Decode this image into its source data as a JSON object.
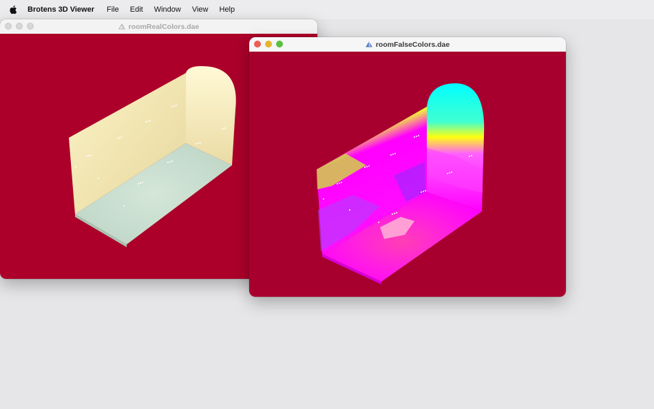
{
  "menubar": {
    "app_name": "Brotens 3D Viewer",
    "items": [
      "File",
      "Edit",
      "Window",
      "View",
      "Help"
    ]
  },
  "windows": {
    "back": {
      "title": "roomRealColors.dae",
      "doc_icon": "3d-document-icon"
    },
    "front": {
      "title": "roomFalseColors.dae",
      "doc_icon": "3d-document-icon"
    }
  },
  "colors": {
    "viewport_bg": "#ac002a",
    "menubar_bg": "#ececee",
    "desktop_bg": "#e6e6e8"
  }
}
